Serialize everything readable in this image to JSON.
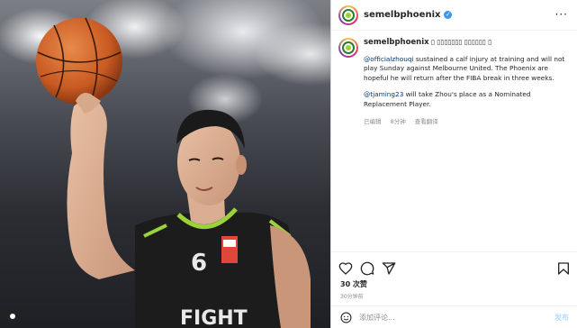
{
  "photo": {
    "jersey_text": "FIGHT",
    "jersey_number": "6"
  },
  "header": {
    "username": "semelbphoenix",
    "verified_mark": "✓",
    "more": "···"
  },
  "caption": {
    "username": "semelbphoenix",
    "emoji_line": "▯ ▯▯▯▯▯▯▯ ▯▯▯▯▯▯ ▯",
    "mention1": "@officialzhouqi",
    "text1": " sustained a calf injury at training and will not play Sunday against Melbourne United. The Phoenix are hopeful he will return after the FIBA break in three weeks.",
    "mention2": "@tjaming23",
    "text2": " will take Zhou's place as a Nominated Replacement Player.",
    "edited": "已编辑",
    "time": "8分钟",
    "translate": "查看翻译"
  },
  "actions": {
    "likes": "30 次赞",
    "posted": "30分钟前"
  },
  "comment": {
    "placeholder": "添加评论...",
    "post": "发布"
  },
  "icons": [
    "heart-icon",
    "comment-icon",
    "share-icon",
    "bookmark-icon",
    "emoji-icon",
    "verified-icon",
    "more-icon"
  ],
  "colors": {
    "verified": "#3897f0",
    "link": "#00376b",
    "jersey_green": "#9bd23a",
    "jersey_black": "#1c1c1c"
  }
}
